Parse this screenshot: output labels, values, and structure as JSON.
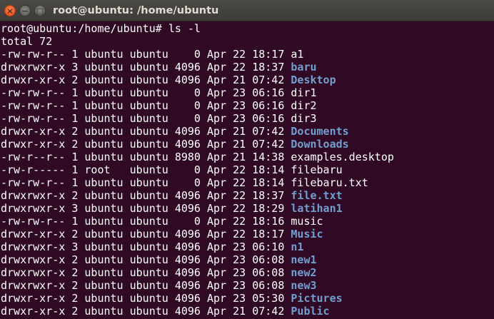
{
  "window": {
    "title": "root@ubuntu: /home/ubuntu",
    "close_glyph": "×",
    "minimize_glyph": "−",
    "maximize_glyph": "□"
  },
  "terminal": {
    "prompt": "root@ubuntu:/home/ubuntu# ",
    "command": "ls -l",
    "total": "total 72",
    "colors": {
      "background": "#300a24",
      "text": "#ffffff",
      "directory": "#729fcf"
    },
    "rows": [
      {
        "perm": "-rw-rw-r--",
        "links": "1",
        "user": "ubuntu",
        "group": "ubuntu",
        "size": "0",
        "date": "Apr 22 18:17",
        "name": "a1",
        "dir": false
      },
      {
        "perm": "drwxrwxr-x",
        "links": "3",
        "user": "ubuntu",
        "group": "ubuntu",
        "size": "4096",
        "date": "Apr 22 18:37",
        "name": "baru",
        "dir": true
      },
      {
        "perm": "drwxr-xr-x",
        "links": "2",
        "user": "ubuntu",
        "group": "ubuntu",
        "size": "4096",
        "date": "Apr 21 07:42",
        "name": "Desktop",
        "dir": true
      },
      {
        "perm": "-rw-rw-r--",
        "links": "1",
        "user": "ubuntu",
        "group": "ubuntu",
        "size": "0",
        "date": "Apr 23 06:16",
        "name": "dir1",
        "dir": false
      },
      {
        "perm": "-rw-rw-r--",
        "links": "1",
        "user": "ubuntu",
        "group": "ubuntu",
        "size": "0",
        "date": "Apr 23 06:16",
        "name": "dir2",
        "dir": false
      },
      {
        "perm": "-rw-rw-r--",
        "links": "1",
        "user": "ubuntu",
        "group": "ubuntu",
        "size": "0",
        "date": "Apr 23 06:16",
        "name": "dir3",
        "dir": false
      },
      {
        "perm": "drwxr-xr-x",
        "links": "2",
        "user": "ubuntu",
        "group": "ubuntu",
        "size": "4096",
        "date": "Apr 21 07:42",
        "name": "Documents",
        "dir": true
      },
      {
        "perm": "drwxr-xr-x",
        "links": "2",
        "user": "ubuntu",
        "group": "ubuntu",
        "size": "4096",
        "date": "Apr 21 07:42",
        "name": "Downloads",
        "dir": true
      },
      {
        "perm": "-rw-r--r--",
        "links": "1",
        "user": "ubuntu",
        "group": "ubuntu",
        "size": "8980",
        "date": "Apr 21 14:38",
        "name": "examples.desktop",
        "dir": false
      },
      {
        "perm": "-rw-r-----",
        "links": "1",
        "user": "root",
        "group": "ubuntu",
        "size": "0",
        "date": "Apr 22 18:14",
        "name": "filebaru",
        "dir": false
      },
      {
        "perm": "-rw-rw-r--",
        "links": "1",
        "user": "ubuntu",
        "group": "ubuntu",
        "size": "0",
        "date": "Apr 22 18:14",
        "name": "filebaru.txt",
        "dir": false
      },
      {
        "perm": "drwxrwxr-x",
        "links": "2",
        "user": "ubuntu",
        "group": "ubuntu",
        "size": "4096",
        "date": "Apr 22 18:37",
        "name": "file.txt",
        "dir": true
      },
      {
        "perm": "drwxrwxr-x",
        "links": "3",
        "user": "ubuntu",
        "group": "ubuntu",
        "size": "4096",
        "date": "Apr 22 18:29",
        "name": "latihan1",
        "dir": true
      },
      {
        "perm": "-rw-rw-r--",
        "links": "1",
        "user": "ubuntu",
        "group": "ubuntu",
        "size": "0",
        "date": "Apr 22 18:16",
        "name": "music",
        "dir": false
      },
      {
        "perm": "drwxr-xr-x",
        "links": "2",
        "user": "ubuntu",
        "group": "ubuntu",
        "size": "4096",
        "date": "Apr 22 18:17",
        "name": "Music",
        "dir": true
      },
      {
        "perm": "drwxrwxr-x",
        "links": "3",
        "user": "ubuntu",
        "group": "ubuntu",
        "size": "4096",
        "date": "Apr 23 06:10",
        "name": "n1",
        "dir": true
      },
      {
        "perm": "drwxrwxr-x",
        "links": "2",
        "user": "ubuntu",
        "group": "ubuntu",
        "size": "4096",
        "date": "Apr 23 06:08",
        "name": "new1",
        "dir": true
      },
      {
        "perm": "drwxrwxr-x",
        "links": "2",
        "user": "ubuntu",
        "group": "ubuntu",
        "size": "4096",
        "date": "Apr 23 06:08",
        "name": "new2",
        "dir": true
      },
      {
        "perm": "drwxrwxr-x",
        "links": "2",
        "user": "ubuntu",
        "group": "ubuntu",
        "size": "4096",
        "date": "Apr 23 06:08",
        "name": "new3",
        "dir": true
      },
      {
        "perm": "drwxr-xr-x",
        "links": "2",
        "user": "ubuntu",
        "group": "ubuntu",
        "size": "4096",
        "date": "Apr 23 05:30",
        "name": "Pictures",
        "dir": true
      },
      {
        "perm": "drwxr-xr-x",
        "links": "2",
        "user": "ubuntu",
        "group": "ubuntu",
        "size": "4096",
        "date": "Apr 21 07:42",
        "name": "Public",
        "dir": true
      }
    ]
  }
}
